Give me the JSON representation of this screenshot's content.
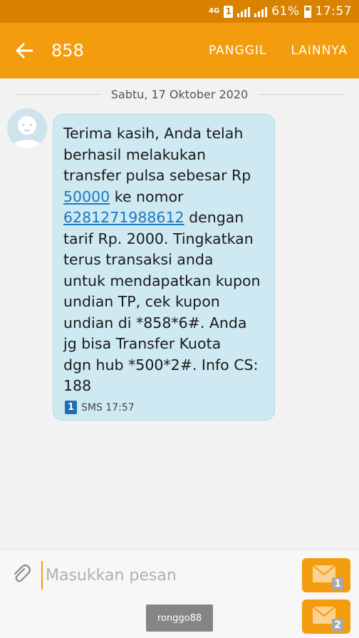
{
  "status_bar": {
    "network": "4G",
    "sim_slot": "1",
    "battery_percent": "61%",
    "time": "17:57"
  },
  "header": {
    "title": "858",
    "call_label": "PANGGIL",
    "more_label": "LAINNYA"
  },
  "conversation": {
    "date": "Sabtu, 17 Oktober 2020",
    "message": {
      "lines_before_amount": [
        "Terima kasih, Anda telah",
        "berhasil melakukan",
        "transfer pulsa sebesar Rp"
      ],
      "amount_link": "50000",
      "after_amount": " ke nomor",
      "phone_link": "6281271988612",
      "after_phone": " dengan",
      "lines_after": [
        "tarif Rp. 2000. Tingkatkan",
        "terus transaksi anda",
        "untuk mendapatkan kupon",
        "undian TP, cek kupon",
        "undian di *858*6#. Anda",
        "jg bisa Transfer Kuota",
        "dgn hub *500*2#. Info CS:",
        "188"
      ],
      "sim_badge": "1",
      "meta": "SMS 17:57"
    }
  },
  "composer": {
    "placeholder": "Masukkan pesan",
    "send_sim1_badge": "1",
    "send_sim2_badge": "2"
  },
  "watermark": "ronggo88",
  "colors": {
    "status_bar": "#d98200",
    "header": "#f39c0d",
    "bubble": "#cfe9f2",
    "link": "#1a78c2"
  }
}
